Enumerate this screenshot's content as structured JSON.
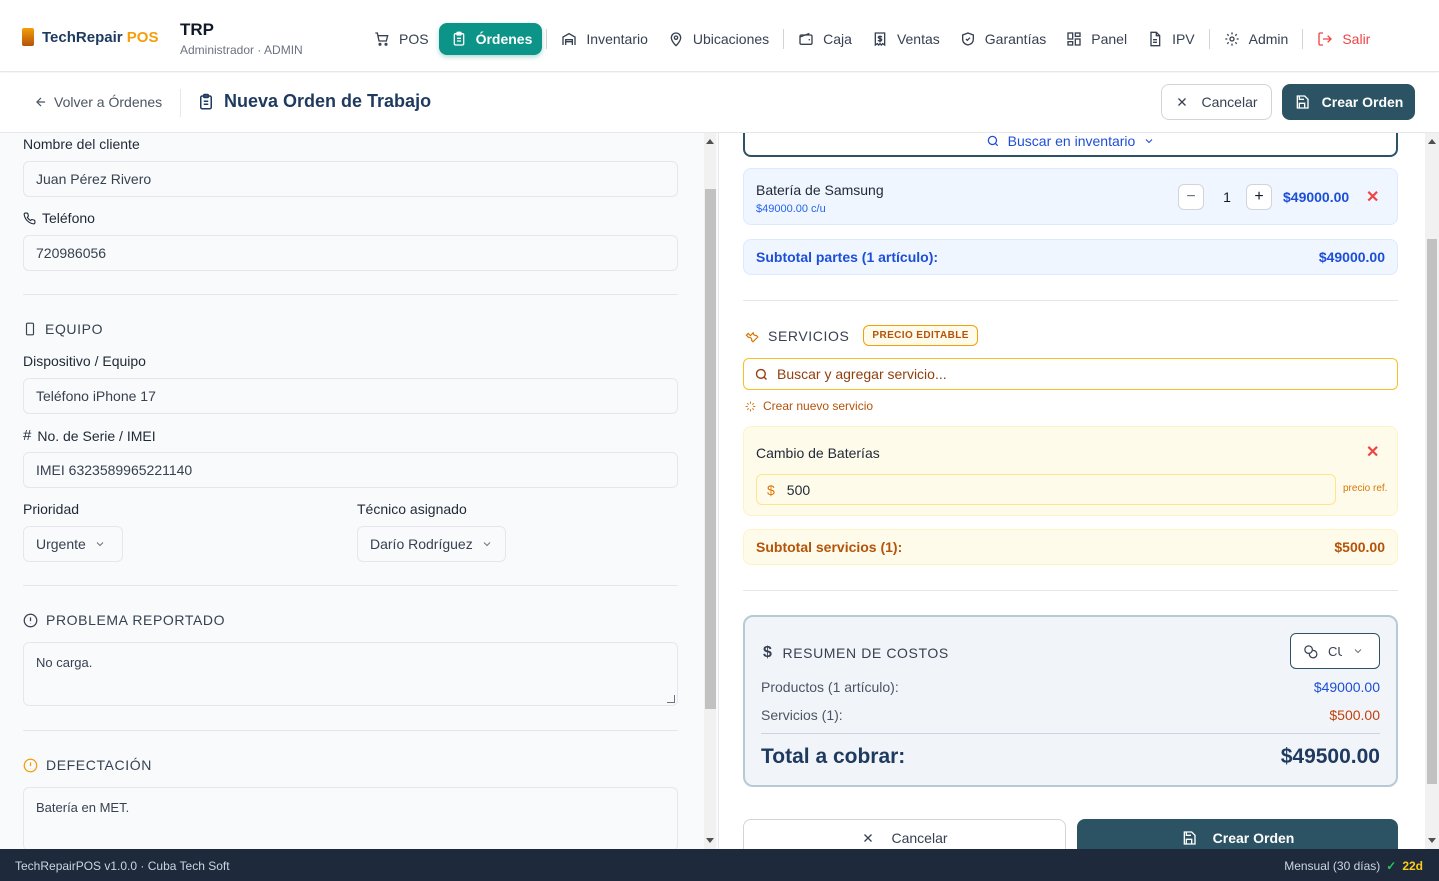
{
  "app": {
    "brand_main": "TechRepair",
    "brand_accent": "POS",
    "shop_code": "TRP",
    "shop_role": "Administrador · ADMIN"
  },
  "nav": {
    "items": [
      {
        "label": "POS",
        "icon": "cart-icon"
      },
      {
        "label": "Órdenes",
        "icon": "clipboard-icon",
        "active": true
      },
      {
        "label": "Inventario",
        "icon": "warehouse-icon"
      },
      {
        "label": "Ubicaciones",
        "icon": "map-pin-icon"
      },
      {
        "label": "Caja",
        "icon": "wallet-icon"
      },
      {
        "label": "Ventas",
        "icon": "receipt-icon"
      },
      {
        "label": "Garantías",
        "icon": "shield-icon"
      },
      {
        "label": "Panel",
        "icon": "grid-icon"
      },
      {
        "label": "IPV",
        "icon": "document-icon"
      },
      {
        "label": "Admin",
        "icon": "gear-icon"
      },
      {
        "label": "Salir",
        "icon": "logout-icon"
      }
    ]
  },
  "subheader": {
    "back_label": "Volver a Órdenes",
    "title": "Nueva Orden de Trabajo",
    "cancel_label": "Cancelar",
    "create_label": "Crear Orden"
  },
  "client": {
    "name_label": "Nombre del cliente",
    "name_value": "Juan Pérez Rivero",
    "phone_label": "Teléfono",
    "phone_value": "720986056"
  },
  "equipment": {
    "section_title": "EQUIPO",
    "device_label": "Dispositivo / Equipo",
    "device_value": "Teléfono iPhone 17",
    "serial_label": "No. de Serie / IMEI",
    "serial_value": "IMEI 6323589965221140",
    "priority_label": "Prioridad",
    "priority_value": "Urgente",
    "tech_label": "Técnico asignado",
    "tech_value": "Darío Rodríguez"
  },
  "problem": {
    "section_title": "PROBLEMA REPORTADO",
    "value": "No carga."
  },
  "defect": {
    "section_title": "DEFECTACIÓN",
    "value": "Batería en MET."
  },
  "parts": {
    "search_label": "Buscar en inventario",
    "items": [
      {
        "name": "Batería de Samsung",
        "unit_price": "$49000.00 c/u",
        "qty": "1",
        "total": "$49000.00"
      }
    ],
    "subtotal_label": "Subtotal partes (1 artículo):",
    "subtotal_value": "$49000.00"
  },
  "services": {
    "section_title": "SERVICIOS",
    "badge": "PRECIO EDITABLE",
    "search_placeholder": "Buscar y agregar servicio...",
    "new_label": "Crear nuevo servicio",
    "items": [
      {
        "name": "Cambio de Baterías",
        "currency": "$",
        "price": "500",
        "ref": "precio ref."
      }
    ],
    "subtotal_label": "Subtotal servicios (1):",
    "subtotal_value": "$500.00"
  },
  "summary": {
    "title": "RESUMEN DE COSTOS",
    "currency_value": "CU",
    "products_label": "Productos (1 artículo):",
    "products_value": "$49000.00",
    "services_label": "Servicios (1):",
    "services_value": "$500.00",
    "total_label": "Total a cobrar:",
    "total_value": "$49500.00"
  },
  "bottom": {
    "cancel_label": "Cancelar",
    "create_label": "Crear Orden"
  },
  "footer": {
    "version": "TechRepairPOS v1.0.0 · Cuba Tech Soft",
    "plan": "Mensual (30 días)",
    "check": "✓",
    "days": "22d"
  },
  "colors": {
    "accent_teal": "#0d9488",
    "primary_dark": "#2c5364",
    "parts_blue": "#1d4ed8",
    "services_amber": "#b45309",
    "danger": "#ef4444"
  }
}
